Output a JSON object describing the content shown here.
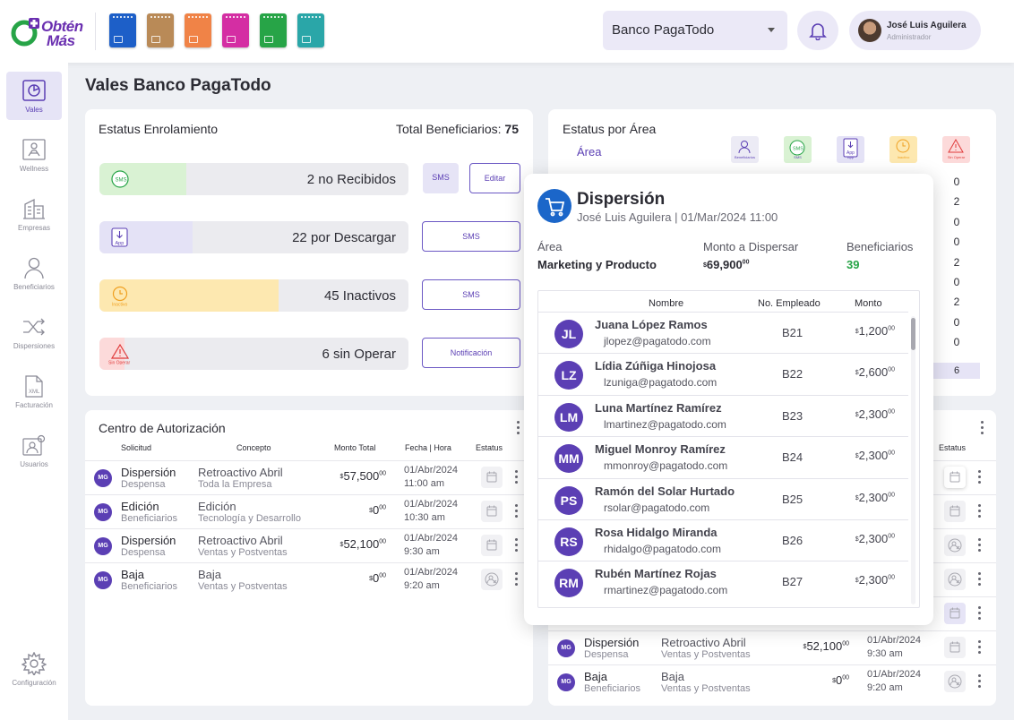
{
  "brand": {
    "logo_line1": "Obtén",
    "logo_line2": "Más"
  },
  "cards": [
    {
      "color": "#1d5fc8",
      "name": "card-blue"
    },
    {
      "color": "#b98a57",
      "name": "card-gold"
    },
    {
      "color": "#f08347",
      "name": "card-orange"
    },
    {
      "color": "#d42ea3",
      "name": "card-magenta"
    },
    {
      "color": "#27a447",
      "name": "card-green"
    },
    {
      "color": "#2aa6a8",
      "name": "card-teal"
    }
  ],
  "header": {
    "bank_select": "Banco PagaTodo",
    "user_name": "José Luis Aguilera",
    "user_role": "Administrador"
  },
  "sidebar": {
    "items": [
      {
        "label": "Vales",
        "icon": "vales-icon",
        "active": true
      },
      {
        "label": "Wellness",
        "icon": "wellness-icon"
      },
      {
        "label": "Empresas",
        "icon": "building-icon"
      },
      {
        "label": "Beneficiarios",
        "icon": "user-icon"
      },
      {
        "label": "Dispersiones",
        "icon": "shuffle-icon"
      },
      {
        "label": "Facturación",
        "icon": "xml-icon"
      },
      {
        "label": "Usuarios",
        "icon": "users-gear-icon"
      }
    ],
    "config_label": "Configuración"
  },
  "page_title": "Vales Banco PagaTodo",
  "enrolamiento": {
    "title": "Estatus Enrolamiento",
    "total_label": "Total Beneficiarios:",
    "total_value": "75",
    "rows": [
      {
        "text": "2 no Recibidos",
        "icon_label": "SMS",
        "fill": 0.28,
        "color": "#d9f2d3",
        "btn1": "SMS",
        "btn2": "Editar"
      },
      {
        "text": "22 por Descargar",
        "icon_label": "App",
        "fill": 0.3,
        "color": "#e4e2f6",
        "btn1": "SMS"
      },
      {
        "text": "45 Inactivos",
        "icon_label": "Inactivo",
        "fill": 0.58,
        "color": "#fde8b0",
        "btn1": "SMS"
      },
      {
        "text": "6 sin Operar",
        "icon_label": "Sin Operar",
        "fill": 0.08,
        "color": "#fcdada",
        "btn1": "Notificación"
      }
    ]
  },
  "area": {
    "title": "Estatus por Área",
    "col_label": "Área",
    "icons": [
      {
        "label": "Beneficiarios",
        "color": "#ecebf5"
      },
      {
        "label": "SMS",
        "color": "#d9f2d3"
      },
      {
        "label": "App",
        "color": "#e4e2f6"
      },
      {
        "label": "Inactivo",
        "color": "#fde8b0"
      },
      {
        "label": "Sin Operar",
        "color": "#fcdada"
      }
    ],
    "last_col": [
      "0",
      "2",
      "0",
      "0",
      "2",
      "0",
      "2",
      "0",
      "0"
    ],
    "total": "6"
  },
  "autorizacion": {
    "title": "Centro de Autorización",
    "headers": [
      "Solicitud",
      "Concepto",
      "Monto Total",
      "Fecha | Hora",
      "Estatus"
    ],
    "rows": [
      {
        "badge": "MG",
        "sol": "Dispersión",
        "sol_sub": "Despensa",
        "con": "Retroactivo Abril",
        "con_sub": "Toda la Empresa",
        "monto": "57,500",
        "cents": "00",
        "fecha": "01/Abr/2024",
        "hora": "11:00 am",
        "icon": "calendar-icon"
      },
      {
        "badge": "MG",
        "sol": "Edición",
        "sol_sub": "Beneficiarios",
        "con": "Edición",
        "con_sub": "Tecnología y Desarrollo",
        "monto": "0",
        "cents": "00",
        "fecha": "01/Abr/2024",
        "hora": "10:30 am",
        "icon": "calendar-icon"
      },
      {
        "badge": "MG",
        "sol": "Dispersión",
        "sol_sub": "Despensa",
        "con": "Retroactivo Abril",
        "con_sub": "Ventas y Postventas",
        "monto": "52,100",
        "cents": "00",
        "fecha": "01/Abr/2024",
        "hora": "9:30 am",
        "icon": "calendar-icon"
      },
      {
        "badge": "MG",
        "sol": "Baja",
        "sol_sub": "Beneficiarios",
        "con": "Baja",
        "con_sub": "Ventas y Postventas",
        "monto": "0",
        "cents": "00",
        "fecha": "01/Abr/2024",
        "hora": "9:20 am",
        "icon": "user-x-icon"
      }
    ]
  },
  "autorizacion2": {
    "status_header": "Estatus",
    "rows": [
      {
        "badge": "MG",
        "sol": "Dispersión",
        "sol_sub": "Despensa",
        "con": "Retroactivo Abril",
        "con_sub": "Ventas y Postventas",
        "monto": "52,100",
        "cents": "00",
        "fecha": "01/Abr/2024",
        "hora": "9:30 am",
        "icon": "calendar-icon"
      },
      {
        "badge": "MG",
        "sol": "Baja",
        "sol_sub": "Beneficiarios",
        "con": "Baja",
        "con_sub": "Ventas y Postventas",
        "monto": "0",
        "cents": "00",
        "fecha": "01/Abr/2024",
        "hora": "9:20 am",
        "icon": "user-x-icon"
      }
    ]
  },
  "dispersion": {
    "title": "Dispersión",
    "subtitle": "José Luis Aguilera | 01/Mar/2024 11:00",
    "area_h": "Área",
    "area_v": "Marketing y Producto",
    "monto_h": "Monto a Dispersar",
    "monto_v": "69,900",
    "monto_c": "00",
    "ben_h": "Beneficiarios",
    "ben_v": "39",
    "cols": [
      "Nombre",
      "No. Empleado",
      "Monto"
    ],
    "rows": [
      {
        "ini": "JL",
        "name": "Juana López Ramos",
        "email": "jlopez@pagatodo.com",
        "no": "B21",
        "monto": "1,200",
        "c": "00"
      },
      {
        "ini": "LZ",
        "name": "Lídia Zúñiga Hinojosa",
        "email": "lzuniga@pagatodo.com",
        "no": "B22",
        "monto": "2,600",
        "c": "00"
      },
      {
        "ini": "LM",
        "name": "Luna Martínez Ramírez",
        "email": "lmartinez@pagatodo.com",
        "no": "B23",
        "monto": "2,300",
        "c": "00"
      },
      {
        "ini": "MM",
        "name": "Miguel Monroy Ramírez",
        "email": "mmonroy@pagatodo.com",
        "no": "B24",
        "monto": "2,300",
        "c": "00"
      },
      {
        "ini": "PS",
        "name": "Ramón del Solar Hurtado",
        "email": "rsolar@pagatodo.com",
        "no": "B25",
        "monto": "2,300",
        "c": "00"
      },
      {
        "ini": "RS",
        "name": "Rosa Hidalgo Miranda",
        "email": "rhidalgo@pagatodo.com",
        "no": "B26",
        "monto": "2,300",
        "c": "00"
      },
      {
        "ini": "RM",
        "name": "Rubén Martínez Rojas",
        "email": "rmartinez@pagatodo.com",
        "no": "B27",
        "monto": "2,300",
        "c": "00"
      }
    ]
  },
  "currency_symbol": "$"
}
